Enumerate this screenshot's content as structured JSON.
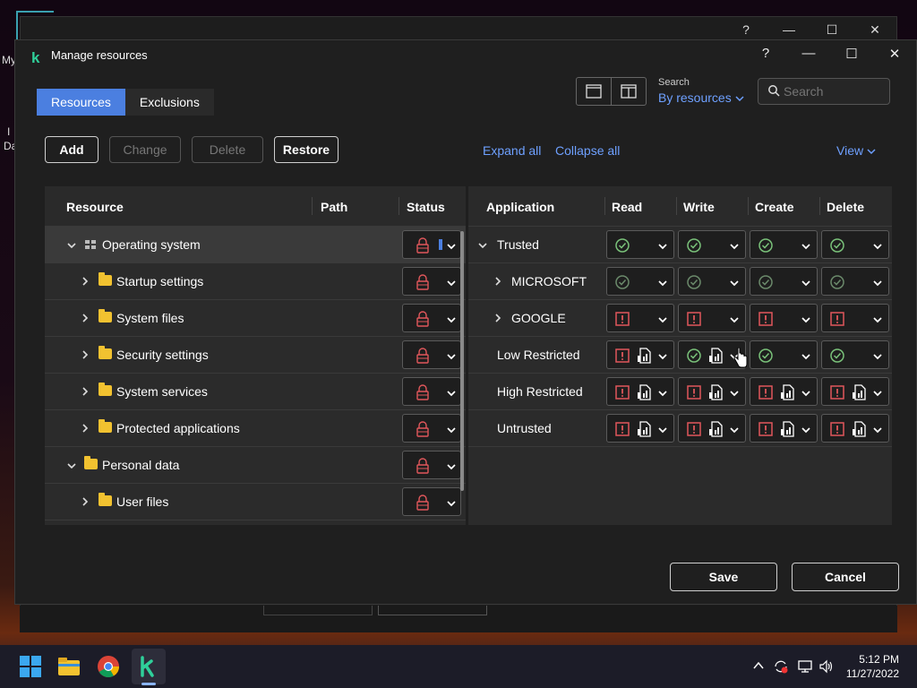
{
  "background_window": {
    "help": "?",
    "minimize": "—",
    "maximize": "☐",
    "close": "✕",
    "left_text_1": "My",
    "left_text_2": "I",
    "left_text_3": "Da"
  },
  "dialog": {
    "logo": "k",
    "title": "Manage resources",
    "help": "?",
    "minimize": "—",
    "maximize": "☐",
    "close": "✕"
  },
  "tabs": [
    {
      "label": "Resources",
      "active": true
    },
    {
      "label": "Exclusions",
      "active": false
    }
  ],
  "search": {
    "label": "Search",
    "by": "By resources",
    "placeholder": "Search"
  },
  "toolbar": {
    "add": "Add",
    "change": "Change",
    "delete": "Delete",
    "restore": "Restore",
    "expand_all": "Expand all",
    "collapse_all": "Collapse all",
    "view": "View"
  },
  "resources_table": {
    "headers": {
      "resource": "Resource",
      "path": "Path",
      "status": "Status"
    },
    "rows": [
      {
        "label": "Operating system",
        "level": 0,
        "expanded": true,
        "icon": "os-icon",
        "selected": true
      },
      {
        "label": "Startup settings",
        "level": 1,
        "expanded": false,
        "icon": "folder-icon"
      },
      {
        "label": "System files",
        "level": 1,
        "expanded": false,
        "icon": "folder-icon"
      },
      {
        "label": "Security settings",
        "level": 1,
        "expanded": false,
        "icon": "folder-icon"
      },
      {
        "label": "System services",
        "level": 1,
        "expanded": false,
        "icon": "folder-icon"
      },
      {
        "label": "Protected applications",
        "level": 1,
        "expanded": false,
        "icon": "folder-icon"
      },
      {
        "label": "Personal data",
        "level": 0,
        "expanded": true,
        "icon": "folder-icon"
      },
      {
        "label": "User files",
        "level": 1,
        "expanded": false,
        "icon": "folder-icon"
      }
    ]
  },
  "applications_table": {
    "headers": {
      "application": "Application",
      "read": "Read",
      "write": "Write",
      "create": "Create",
      "delete": "Delete"
    },
    "rows": [
      {
        "label": "Trusted",
        "expander": "down",
        "cells": [
          "allow",
          "allow",
          "allow",
          "allow"
        ],
        "logging": [
          false,
          false,
          false,
          false
        ]
      },
      {
        "label": "MICROSOFT",
        "expander": "right",
        "cells": [
          "allow-dim",
          "allow-dim",
          "allow-dim",
          "allow-dim"
        ],
        "logging": [
          false,
          false,
          false,
          false
        ]
      },
      {
        "label": "GOOGLE",
        "expander": "right",
        "cells": [
          "deny",
          "deny",
          "deny",
          "deny"
        ],
        "logging": [
          false,
          false,
          false,
          false
        ]
      },
      {
        "label": "Low Restricted",
        "expander": "none",
        "cells": [
          "deny",
          "allow",
          "allow",
          "allow"
        ],
        "logging": [
          true,
          true,
          false,
          false
        ]
      },
      {
        "label": "High Restricted",
        "expander": "none",
        "cells": [
          "deny",
          "deny",
          "deny",
          "deny"
        ],
        "logging": [
          true,
          true,
          true,
          true
        ]
      },
      {
        "label": "Untrusted",
        "expander": "none",
        "cells": [
          "deny",
          "deny",
          "deny",
          "deny"
        ],
        "logging": [
          true,
          true,
          true,
          true
        ]
      }
    ]
  },
  "footer": {
    "save": "Save",
    "cancel": "Cancel"
  },
  "taskbar": {
    "time": "5:12 PM",
    "date": "11/27/2022"
  },
  "colors": {
    "accent": "#4b7fe0",
    "link": "#6ea0ff",
    "allow": "#7ac27a",
    "deny": "#e0575b",
    "folder": "#f2c230"
  }
}
